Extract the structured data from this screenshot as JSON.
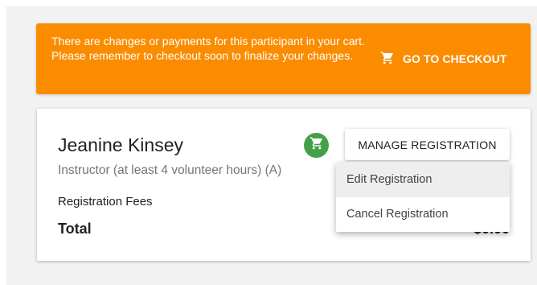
{
  "banner": {
    "message": "There are changes or payments for this participant in your cart. Please remember to checkout soon to finalize your changes.",
    "checkout_label": "GO TO CHECKOUT",
    "checkout_icon": "cart-icon",
    "color": "#fb8c00"
  },
  "participant": {
    "name": "Jeanine Kinsey",
    "role": "Instructor (at least 4 volunteer hours) (A)",
    "fees_label": "Registration Fees",
    "total_label": "Total",
    "total_value": "$0.00",
    "cart_badge_icon": "cart-icon",
    "cart_badge_color": "#43a047"
  },
  "actions": {
    "manage_label": "MANAGE REGISTRATION",
    "menu_items": [
      {
        "label": "Edit Registration"
      },
      {
        "label": "Cancel Registration"
      }
    ]
  }
}
